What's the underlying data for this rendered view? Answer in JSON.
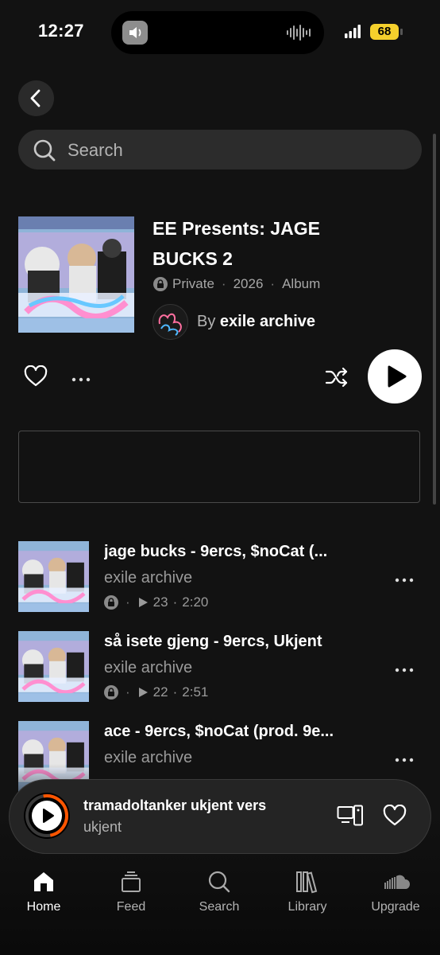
{
  "status_bar": {
    "time": "12:27",
    "battery": "68"
  },
  "search": {
    "placeholder": "Search"
  },
  "album": {
    "title": "EE Presents: JAGE BUCKS 2",
    "privacy": "Private",
    "year": "2026",
    "type": "Album",
    "by_prefix": "By",
    "artist": "exile archive"
  },
  "tracks": [
    {
      "title": "jage bucks - 9ercs, $noCat (...",
      "artist": "exile archive",
      "plays": "23",
      "duration": "2:20"
    },
    {
      "title": "så isete gjeng - 9ercs, Ukjent",
      "artist": "exile archive",
      "plays": "22",
      "duration": "2:51"
    },
    {
      "title": "ace - 9ercs, $noCat (prod. 9e...",
      "artist": "exile archive"
    }
  ],
  "now_playing": {
    "title": "tramadoltanker ukjent vers",
    "artist": "ukjent"
  },
  "tabs": [
    {
      "label": "Home",
      "icon": "home-icon",
      "active": true
    },
    {
      "label": "Feed",
      "icon": "feed-icon"
    },
    {
      "label": "Search",
      "icon": "search-icon"
    },
    {
      "label": "Library",
      "icon": "library-icon"
    },
    {
      "label": "Upgrade",
      "icon": "cloud-icon"
    }
  ],
  "colors": {
    "background": "#121212",
    "accent": "#ff5500",
    "battery": "#f5d02c"
  }
}
